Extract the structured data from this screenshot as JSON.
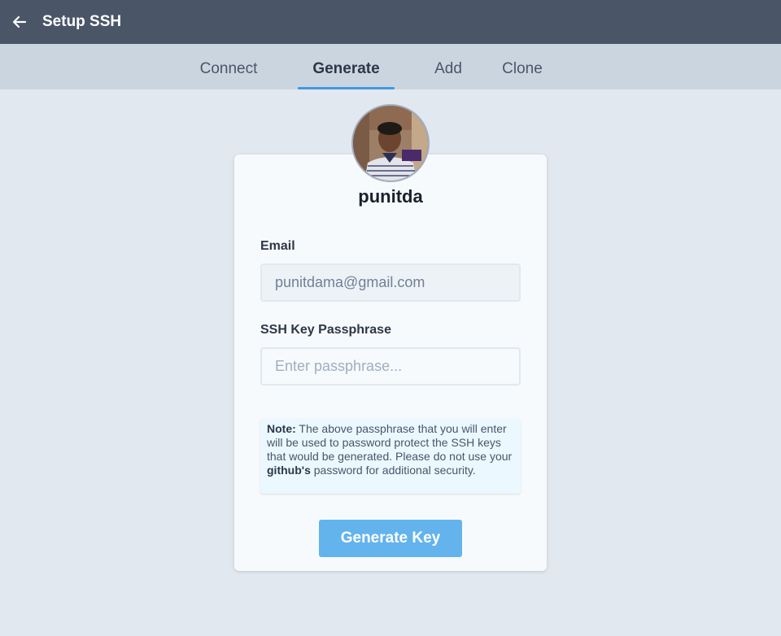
{
  "header": {
    "title": "Setup SSH",
    "back_icon": "arrow-left-icon"
  },
  "tabs": [
    {
      "label": "Connect",
      "active": false
    },
    {
      "label": "Generate",
      "active": true
    },
    {
      "label": "Add",
      "active": false
    },
    {
      "label": "Clone",
      "active": false
    }
  ],
  "profile": {
    "username": "punitda"
  },
  "form": {
    "email_label": "Email",
    "email_value": "punitdama@gmail.com",
    "passphrase_label": "SSH Key Passphrase",
    "passphrase_placeholder": "Enter passphrase...",
    "passphrase_value": ""
  },
  "note": {
    "prefix": "Note:",
    "text_before": " The above passphrase that you will enter will be used to password protect the SSH keys that would be generated. Please do not use your ",
    "emphasis": "github's",
    "text_after": " password for additional security."
  },
  "actions": {
    "generate_label": "Generate Key"
  },
  "colors": {
    "header_bg": "#4a5568",
    "tabbar_bg": "#cbd5e0",
    "accent": "#4299e1",
    "button_bg": "#63b3ed",
    "note_bg": "#ebf8ff"
  }
}
